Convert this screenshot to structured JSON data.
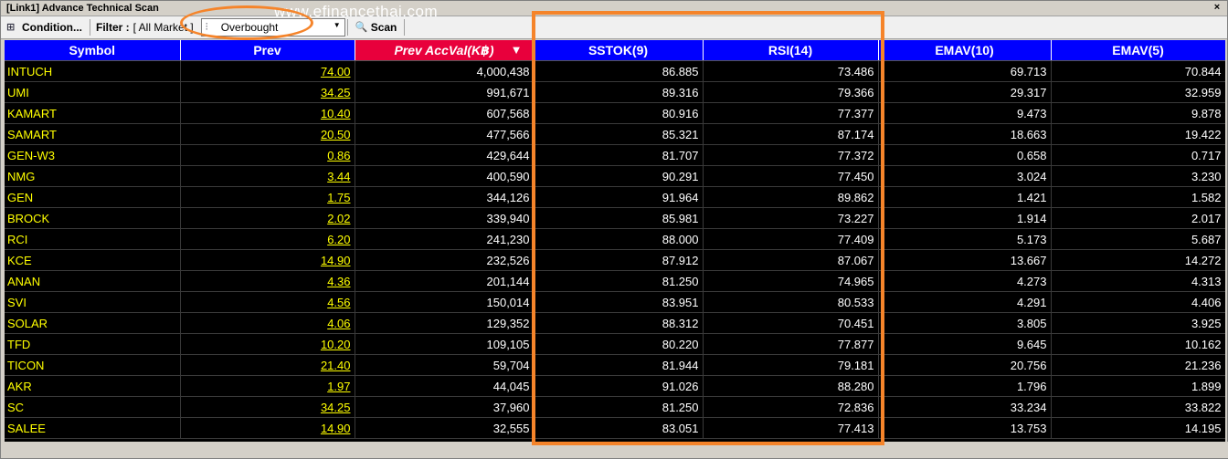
{
  "window": {
    "title": "[Link1] Advance Technical Scan",
    "close_glyph": "×"
  },
  "watermark": "www.efinancethai.com",
  "toolbar": {
    "condition_label": "Condition...",
    "filter_label": "Filter :",
    "filter_value": "[ All Market ]",
    "select_value": "Overbought",
    "scan_label": "Scan"
  },
  "columns": [
    "Symbol",
    "Prev",
    "Prev AccVal(K฿)",
    "SSTOK(9)",
    "RSI(14)",
    "EMAV(10)",
    "EMAV(5)"
  ],
  "sorted_column": "Prev AccVal(K฿)",
  "rows": [
    [
      "INTUCH",
      "74.00",
      "4,000,438",
      "86.885",
      "73.486",
      "69.713",
      "70.844"
    ],
    [
      "UMI",
      "34.25",
      "991,671",
      "89.316",
      "79.366",
      "29.317",
      "32.959"
    ],
    [
      "KAMART",
      "10.40",
      "607,568",
      "80.916",
      "77.377",
      "9.473",
      "9.878"
    ],
    [
      "SAMART",
      "20.50",
      "477,566",
      "85.321",
      "87.174",
      "18.663",
      "19.422"
    ],
    [
      "GEN-W3",
      "0.86",
      "429,644",
      "81.707",
      "77.372",
      "0.658",
      "0.717"
    ],
    [
      "NMG",
      "3.44",
      "400,590",
      "90.291",
      "77.450",
      "3.024",
      "3.230"
    ],
    [
      "GEN",
      "1.75",
      "344,126",
      "91.964",
      "89.862",
      "1.421",
      "1.582"
    ],
    [
      "BROCK",
      "2.02",
      "339,940",
      "85.981",
      "73.227",
      "1.914",
      "2.017"
    ],
    [
      "RCI",
      "6.20",
      "241,230",
      "88.000",
      "77.409",
      "5.173",
      "5.687"
    ],
    [
      "KCE",
      "14.90",
      "232,526",
      "87.912",
      "87.067",
      "13.667",
      "14.272"
    ],
    [
      "ANAN",
      "4.36",
      "201,144",
      "81.250",
      "74.965",
      "4.273",
      "4.313"
    ],
    [
      "SVI",
      "4.56",
      "150,014",
      "83.951",
      "80.533",
      "4.291",
      "4.406"
    ],
    [
      "SOLAR",
      "4.06",
      "129,352",
      "88.312",
      "70.451",
      "3.805",
      "3.925"
    ],
    [
      "TFD",
      "10.20",
      "109,105",
      "80.220",
      "77.877",
      "9.645",
      "10.162"
    ],
    [
      "TICON",
      "21.40",
      "59,704",
      "81.944",
      "79.181",
      "20.756",
      "21.236"
    ],
    [
      "AKR",
      "1.97",
      "44,045",
      "91.026",
      "88.280",
      "1.796",
      "1.899"
    ],
    [
      "SC",
      "34.25",
      "37,960",
      "81.250",
      "72.836",
      "33.234",
      "33.822"
    ],
    [
      "SALEE",
      "14.90",
      "32,555",
      "83.051",
      "77.413",
      "13.753",
      "14.195"
    ]
  ],
  "colors": {
    "header": "#0000ff",
    "sorted_header": "#e8003c",
    "symbol": "#ffff00",
    "annotation": "#f5842a"
  }
}
